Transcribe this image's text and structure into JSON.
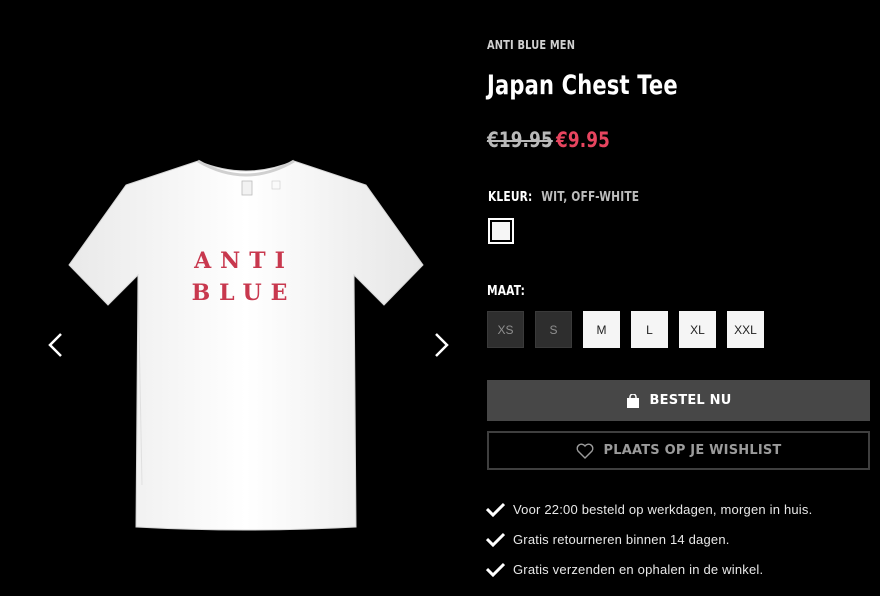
{
  "gallery": {
    "prev_icon": "chevron-left-icon",
    "next_icon": "chevron-right-icon",
    "print_line1": "ANTI",
    "print_line2": "BLUE"
  },
  "product": {
    "brand": "ANTI BLUE MEN",
    "title": "Japan Chest Tee",
    "price_old": "€19.95",
    "price_new": "€9.95",
    "color_label": "KLEUR:",
    "color_value": "WIT, OFF-WHITE",
    "size_label": "MAAT:",
    "sizes": [
      {
        "label": "XS",
        "available": false
      },
      {
        "label": "S",
        "available": false
      },
      {
        "label": "M",
        "available": true
      },
      {
        "label": "L",
        "available": true
      },
      {
        "label": "XL",
        "available": true
      },
      {
        "label": "XXL",
        "available": true
      }
    ]
  },
  "actions": {
    "order_label": "BESTEL NU",
    "order_icon": "shopping-bag-icon",
    "wishlist_label": "PLAATS OP JE WISHLIST",
    "wishlist_icon": "heart-icon"
  },
  "usps": [
    "Voor 22:00 besteld op werkdagen, morgen in huis.",
    "Gratis retourneren binnen 14 dagen.",
    "Gratis verzenden en ophalen in de winkel."
  ],
  "colors": {
    "background": "#000000",
    "sale_price": "#e7455f",
    "order_button": "#474747",
    "print_red": "#c8384e"
  }
}
